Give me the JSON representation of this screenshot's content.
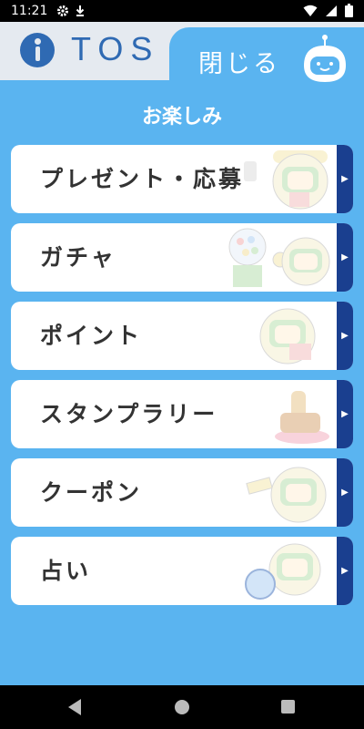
{
  "status_bar": {
    "time": "11:21",
    "icons": [
      "gear-icon",
      "download-icon",
      "wifi-icon",
      "signal-icon",
      "battery-icon"
    ]
  },
  "app_bar": {
    "logo_text": "TOS"
  },
  "close_tab": {
    "label": "閉じる"
  },
  "page_title": "お楽しみ",
  "menu": {
    "items": [
      {
        "label": "プレゼント・応募"
      },
      {
        "label": "ガチャ"
      },
      {
        "label": "ポイント"
      },
      {
        "label": "スタンプラリー"
      },
      {
        "label": "クーポン"
      },
      {
        "label": "占い"
      }
    ],
    "arrow_glyph": "▶"
  },
  "colors": {
    "background": "#5ab4f0",
    "arrow_bar": "#1a3f8f",
    "logo": "#2f6ab3"
  }
}
